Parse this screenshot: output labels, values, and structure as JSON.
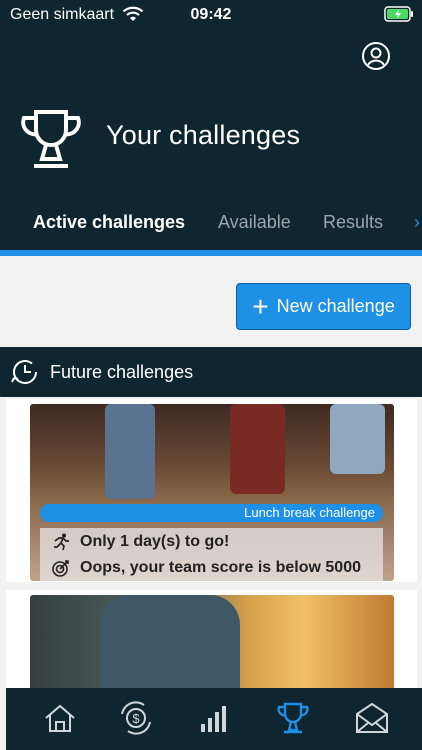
{
  "status": {
    "carrier": "Geen simkaart",
    "time": "09:42"
  },
  "header": {
    "title": "Your challenges",
    "user_icon": "user-circle-icon",
    "trophy_icon": "trophy-icon"
  },
  "tabs": [
    {
      "label": "Active challenges",
      "active": true
    },
    {
      "label": "Available",
      "active": false
    },
    {
      "label": "Results",
      "active": false
    }
  ],
  "new_challenge": {
    "label": "New challenge"
  },
  "section": {
    "label": "Future challenges"
  },
  "cards": [
    {
      "badge": "Lunch break challenge",
      "line1": "Only 1 day(s) to go!",
      "line2": "Oops, your team score is below 5000"
    }
  ],
  "nav": [
    {
      "name": "home-icon"
    },
    {
      "name": "rewards-icon"
    },
    {
      "name": "stats-icon"
    },
    {
      "name": "trophy-icon",
      "active": true
    },
    {
      "name": "mail-icon"
    }
  ],
  "colors": {
    "dark": "#0f2530",
    "accent": "#1e90e6"
  }
}
